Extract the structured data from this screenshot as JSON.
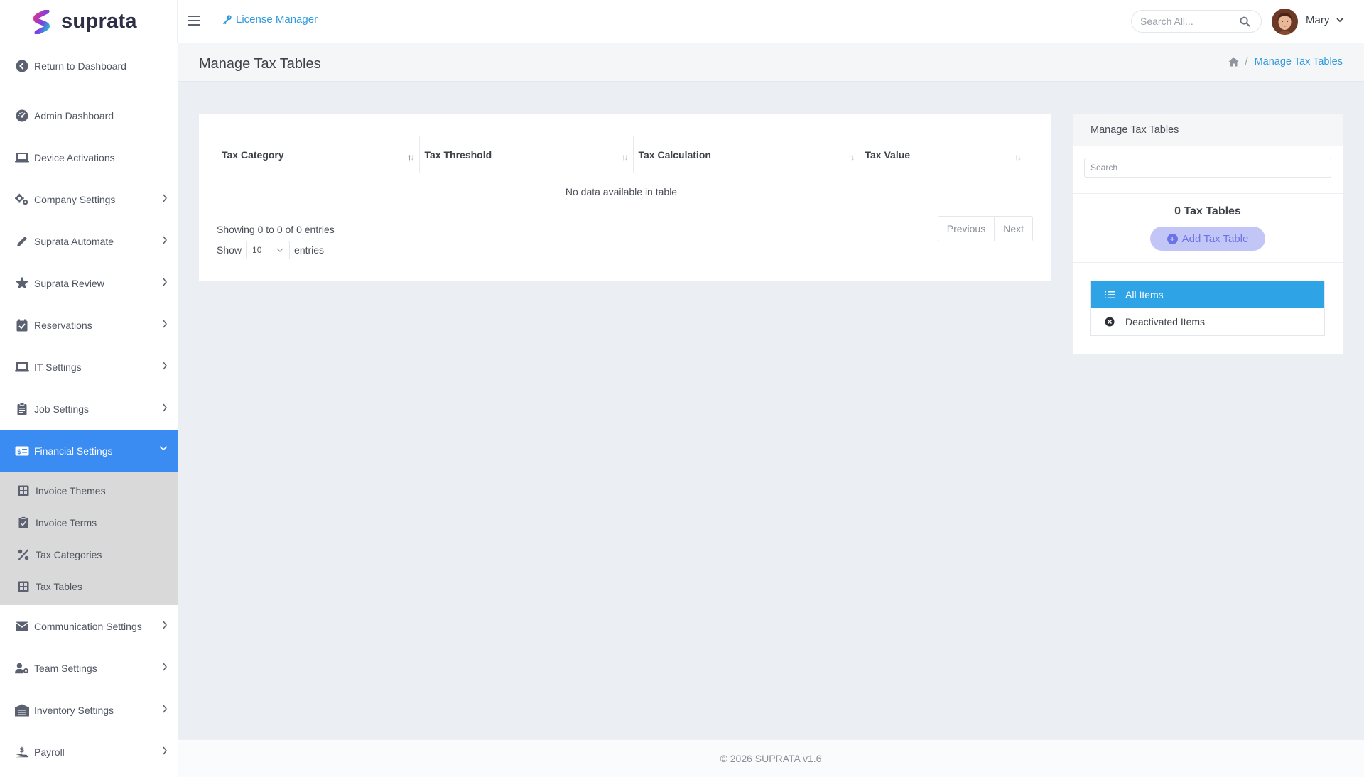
{
  "header": {
    "brand": "suprata",
    "license_link": "License Manager",
    "search_placeholder": "Search All...",
    "user_name": "Mary"
  },
  "sidebar": {
    "return_label": "Return to Dashboard",
    "items": [
      {
        "label": "Admin Dashboard",
        "icon": "gauge-icon"
      },
      {
        "label": "Device Activations",
        "icon": "laptop-icon"
      },
      {
        "label": "Company Settings",
        "icon": "gears-icon"
      },
      {
        "label": "Suprata Automate",
        "icon": "pencil-icon"
      },
      {
        "label": "Suprata Review",
        "icon": "star-icon"
      },
      {
        "label": "Reservations",
        "icon": "calendar-check-icon"
      },
      {
        "label": "IT Settings",
        "icon": "laptop-icon"
      },
      {
        "label": "Job Settings",
        "icon": "clipboard-icon"
      },
      {
        "label": "Financial Settings",
        "icon": "money-card-icon"
      },
      {
        "label": "Communication Settings",
        "icon": "envelope-icon"
      },
      {
        "label": "Team Settings",
        "icon": "user-gear-icon"
      },
      {
        "label": "Inventory Settings",
        "icon": "warehouse-icon"
      },
      {
        "label": "Payroll",
        "icon": "hand-dollar-icon"
      }
    ],
    "active_item": "Financial Settings",
    "sub_items": [
      {
        "label": "Invoice Themes",
        "icon": "table-grid-icon"
      },
      {
        "label": "Invoice Terms",
        "icon": "clipboard-check-icon"
      },
      {
        "label": "Tax Categories",
        "icon": "percent-icon"
      },
      {
        "label": "Tax Tables",
        "icon": "table-grid-icon"
      }
    ]
  },
  "page": {
    "title": "Manage Tax Tables",
    "breadcrumb_current": "Manage Tax Tables"
  },
  "table": {
    "columns": [
      "Tax Category",
      "Tax Threshold",
      "Tax Calculation",
      "Tax Value"
    ],
    "empty_message": "No data available in table",
    "info": "Showing 0 to 0 of 0 entries",
    "show_label": "Show",
    "page_size": "10",
    "entries_label": "entries",
    "prev_label": "Previous",
    "next_label": "Next"
  },
  "side_panel": {
    "title": "Manage Tax Tables",
    "search_placeholder": "Search",
    "count_label": "0 Tax Tables",
    "add_button": "Add Tax Table",
    "filters": [
      {
        "label": "All Items",
        "icon": "list-icon",
        "active": true
      },
      {
        "label": "Deactivated Items",
        "icon": "circle-x-icon",
        "active": false
      }
    ]
  },
  "footer": {
    "text": "© 2026 SUPRATA v1.6"
  },
  "colors": {
    "accent": "#3b8cf2",
    "link": "#2e9adf",
    "filter_active": "#2ea3e6",
    "add_button_bg": "#c2c6f7"
  }
}
